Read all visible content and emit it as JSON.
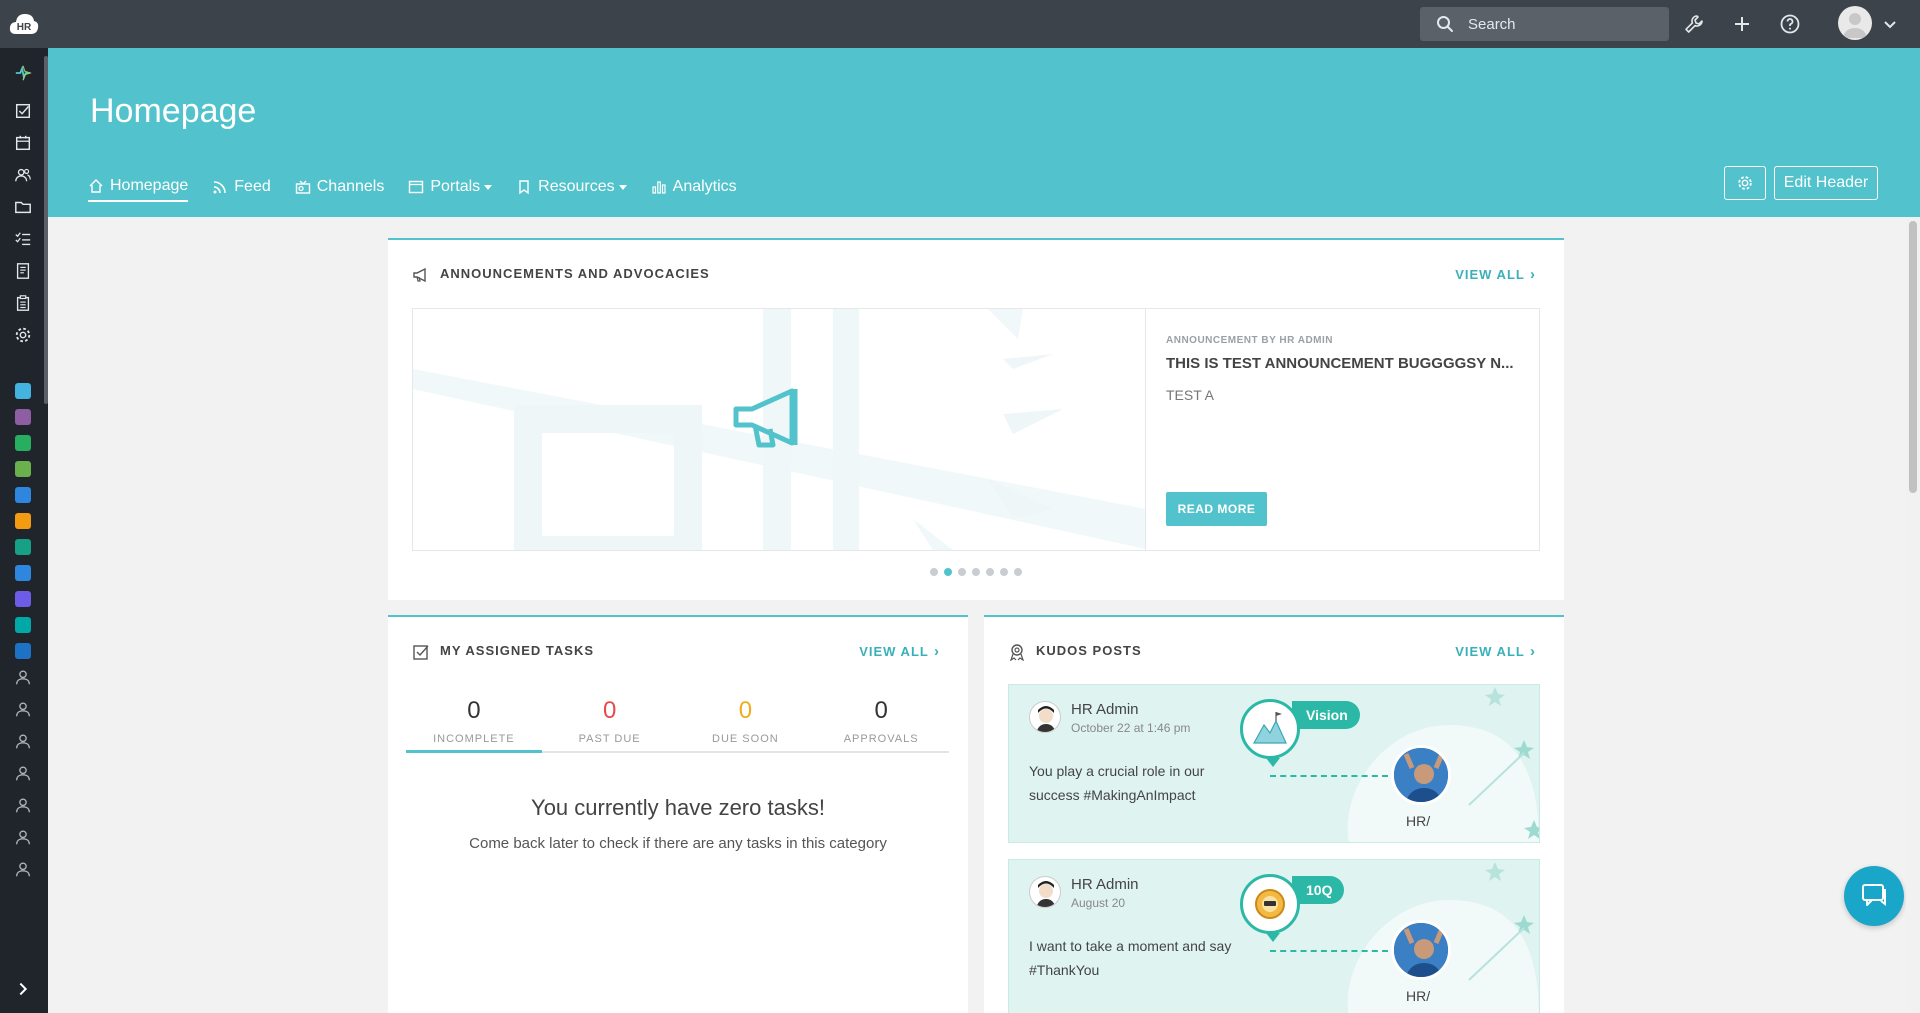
{
  "topbar": {
    "logo_text": "HR",
    "search_placeholder": "Search",
    "icons": [
      "wrench-icon",
      "plus-icon",
      "help-icon",
      "user-avatar",
      "chevron-down-icon"
    ]
  },
  "sidebar": {
    "icons": [
      "activity-icon",
      "tasks-icon",
      "calendar-icon",
      "people-icon",
      "folder-icon",
      "checklist-icon",
      "notes-icon",
      "clipboard-icon",
      "settings-icon"
    ],
    "apps": [
      {
        "name": "app-analytics",
        "color": "#45b3e0"
      },
      {
        "name": "app-alert",
        "color": "#8e5ea2"
      },
      {
        "name": "app-search",
        "color": "#27ae60"
      },
      {
        "name": "app-finance",
        "color": "#6ab04c"
      },
      {
        "name": "app-mail",
        "color": "#2e86de"
      },
      {
        "name": "app-orange",
        "color": "#f39c12"
      },
      {
        "name": "app-docs",
        "color": "#16a085"
      },
      {
        "name": "app-find",
        "color": "#2e86de"
      },
      {
        "name": "app-report",
        "color": "#6c5ce7"
      },
      {
        "name": "app-globe",
        "color": "#00a8a8"
      },
      {
        "name": "app-outlook",
        "color": "#1e72c6"
      }
    ],
    "users_count": 7
  },
  "header": {
    "title": "Homepage",
    "nav": [
      {
        "label": "Homepage",
        "icon": "home-icon",
        "active": true
      },
      {
        "label": "Feed",
        "icon": "rss-icon"
      },
      {
        "label": "Channels",
        "icon": "channels-icon"
      },
      {
        "label": "Portals",
        "icon": "portal-icon",
        "dropdown": true
      },
      {
        "label": "Resources",
        "icon": "bookmark-icon",
        "dropdown": true
      },
      {
        "label": "Analytics",
        "icon": "chart-icon"
      }
    ],
    "edit_header_label": "Edit Header"
  },
  "announcements": {
    "title": "ANNOUNCEMENTS AND ADVOCACIES",
    "view_all": "VIEW ALL",
    "item": {
      "by": "ANNOUNCEMENT BY HR ADMIN",
      "title": "THIS IS TEST ANNOUNCEMENT BUGGGGSY N...",
      "subtitle": "TEST A",
      "read_more": "READ MORE"
    },
    "pages": 7,
    "active_page": 2
  },
  "tasks": {
    "title": "MY ASSIGNED TASKS",
    "view_all": "VIEW ALL",
    "tabs": [
      {
        "count": "0",
        "label": "INCOMPLETE",
        "color": "#333333"
      },
      {
        "count": "0",
        "label": "PAST DUE",
        "color": "#e64b4b"
      },
      {
        "count": "0",
        "label": "DUE SOON",
        "color": "#f0ad1a"
      },
      {
        "count": "0",
        "label": "APPROVALS",
        "color": "#333333"
      }
    ],
    "empty_title": "You currently have zero tasks!",
    "empty_sub": "Come back later to check if there are any tasks in this category"
  },
  "kudos": {
    "title": "KUDOS POSTS",
    "view_all": "VIEW ALL",
    "posts": [
      {
        "author": "HR Admin",
        "date": "October 22 at 1:46 pm",
        "message": "You play a crucial role in our success #MakingAnImpact",
        "badge": "Vision",
        "recipient": "HR/"
      },
      {
        "author": "HR Admin",
        "date": "August 20",
        "message": "I want to take a moment and say #ThankYou",
        "badge": "10Q",
        "recipient": "HR/"
      }
    ]
  }
}
